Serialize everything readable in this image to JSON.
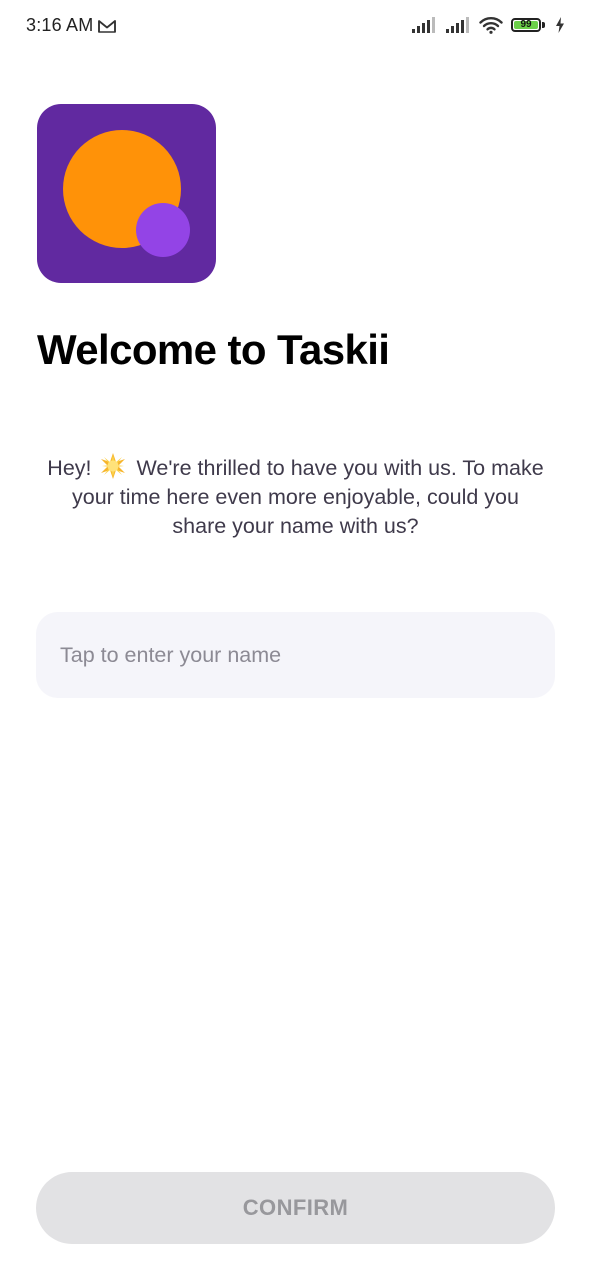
{
  "status_bar": {
    "time": "3:16 AM",
    "notification_icon": "gmail-icon",
    "battery_level": "99",
    "battery_fill_fraction": 0.99,
    "colors": {
      "battery_fill": "#6cd04a"
    }
  },
  "logo": {
    "icon": "app-logo",
    "colors": {
      "background": "#6129a0",
      "big_circle": "#ff9208",
      "small_circle": "#9344e6"
    }
  },
  "title": "Welcome to Taskii",
  "intro": {
    "line1_before_emoji": "Hey!",
    "emoji": "sun-emoji",
    "line1_after_emoji": "We're thrilled to have you with us. To make",
    "line2": "your time here even more enjoyable, could you",
    "line3": "share your name with us?"
  },
  "name_input": {
    "placeholder": "Tap to enter your name",
    "value": ""
  },
  "confirm_button": {
    "label": "CONFIRM",
    "enabled": false
  }
}
